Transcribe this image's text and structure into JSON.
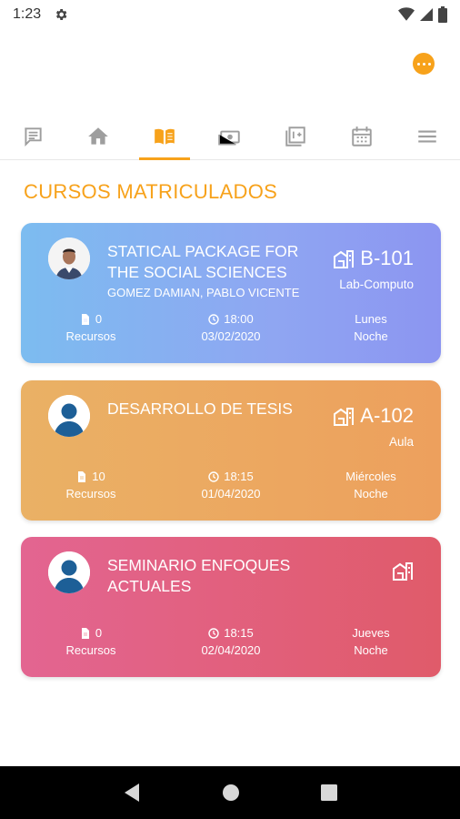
{
  "status_bar": {
    "time": "1:23"
  },
  "section_title": "CURSOS MATRICULADOS",
  "tabs": [
    {
      "icon": "chat-icon"
    },
    {
      "icon": "home-icon"
    },
    {
      "icon": "book-open-icon",
      "active": true
    },
    {
      "icon": "money-icon"
    },
    {
      "icon": "grades-icon"
    },
    {
      "icon": "calendar-icon"
    },
    {
      "icon": "menu-icon"
    }
  ],
  "courses": [
    {
      "title": "STATICAL PACKAGE FOR THE SOCIAL SCIENCES",
      "teacher": "GOMEZ DAMIAN, PABLO VICENTE",
      "room_code": "B-101",
      "room_type": "Lab-Computo",
      "resources_count": "0",
      "resources_label": "Recursos",
      "time": "18:00",
      "date": "03/02/2020",
      "day": "Lunes",
      "shift": "Noche",
      "avatar": "photo"
    },
    {
      "title": "DESARROLLO DE TESIS",
      "teacher": "",
      "room_code": "A-102",
      "room_type": "Aula",
      "resources_count": "10",
      "resources_label": "Recursos",
      "time": "18:15",
      "date": "01/04/2020",
      "day": "Miércoles",
      "shift": "Noche",
      "avatar": "placeholder"
    },
    {
      "title": "SEMINARIO ENFOQUES ACTUALES",
      "teacher": "",
      "room_code": "",
      "room_type": "",
      "resources_count": "0",
      "resources_label": "Recursos",
      "time": "18:15",
      "date": "02/04/2020",
      "day": "Jueves",
      "shift": "Noche",
      "avatar": "placeholder"
    }
  ],
  "colors": {
    "accent": "#f7a21b",
    "card_1": "#8fa6f2",
    "card_2": "#eca760",
    "card_3": "#e15f7d"
  }
}
